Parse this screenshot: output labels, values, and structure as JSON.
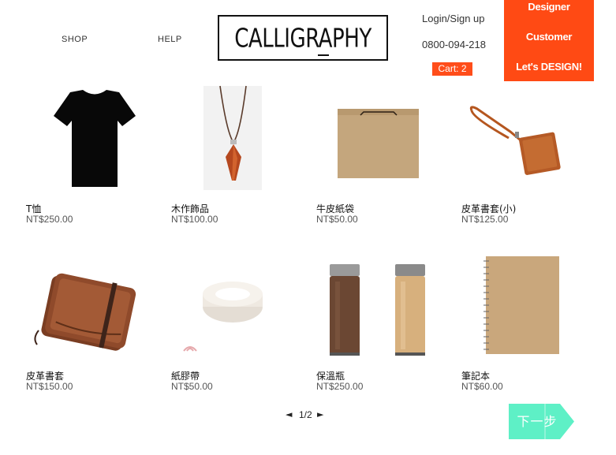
{
  "nav": {
    "shop": "SHOP",
    "help": "HELP"
  },
  "logo": {
    "text": "CALLIGRAPHY"
  },
  "account": {
    "login": "Login/Sign up",
    "phone": "0800-094-218",
    "cart": "Cart: 2"
  },
  "panel": {
    "items": [
      "Designer",
      "Customer",
      "Let's DESIGN!"
    ]
  },
  "colors": {
    "accent": "#ff4a14",
    "next_button": "#5ef0c6"
  },
  "products": [
    {
      "name": "T恤",
      "price": "NT$250.00",
      "icon": "tshirt-image"
    },
    {
      "name": "木作飾品",
      "price": "NT$100.00",
      "icon": "wooden-pendant-image"
    },
    {
      "name": "牛皮紙袋",
      "price": "NT$50.00",
      "icon": "kraft-bag-image"
    },
    {
      "name": "皮革書套(小)",
      "price": "NT$125.00",
      "icon": "leather-card-holder-image"
    },
    {
      "name": "皮革書套",
      "price": "NT$150.00",
      "icon": "leather-book-cover-image"
    },
    {
      "name": "紙膠帶",
      "price": "NT$50.00",
      "icon": "paper-tape-image"
    },
    {
      "name": "保溫瓶",
      "price": "NT$250.00",
      "icon": "thermos-image"
    },
    {
      "name": "筆記本",
      "price": "NT$60.00",
      "icon": "notebook-image"
    }
  ],
  "pager": {
    "prev": "◄",
    "page": "1/2",
    "next": "►"
  },
  "next_button": {
    "label": "下一步"
  }
}
